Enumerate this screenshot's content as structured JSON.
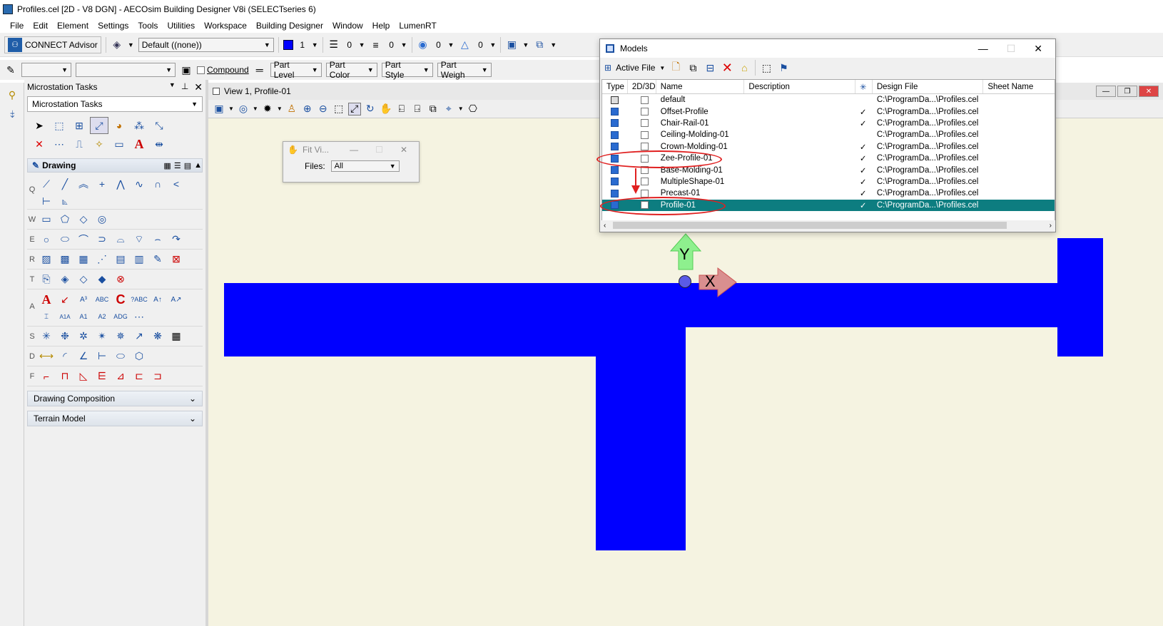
{
  "window": {
    "title": "Profiles.cel [2D - V8 DGN] - AECOsim Building Designer V8i (SELECTseries 6)"
  },
  "menu": [
    "File",
    "Edit",
    "Element",
    "Settings",
    "Tools",
    "Utilities",
    "Workspace",
    "Building Designer",
    "Window",
    "Help",
    "LumenRT"
  ],
  "toolbar1": {
    "connect_label": "CONNECT Advisor",
    "level_value": "Default ((none))",
    "color_value": "1",
    "style_value": "0",
    "weight_value": "0",
    "transparency_value": "0",
    "priority_value": "0"
  },
  "toolbar2": {
    "compound_label": "Compound",
    "part_level": "Part Level",
    "part_color": "Part Color",
    "part_style": "Part Style",
    "part_weight": "Part Weigh"
  },
  "tasks": {
    "panel_title": "Microstation Tasks",
    "combo_value": "Microstation Tasks",
    "drawing_section": "Drawing",
    "row_labels": [
      "Q",
      "W",
      "E",
      "R",
      "T",
      "A",
      "S",
      "D",
      "F"
    ],
    "collapsed": [
      "Drawing Composition",
      "Terrain Model"
    ]
  },
  "view": {
    "title": "View 1, Profile-01"
  },
  "fit_dialog": {
    "title": "Fit Vi...",
    "files_label": "Files:",
    "files_value": "All"
  },
  "models": {
    "title": "Models",
    "active_file": "Active File",
    "columns": [
      "Type",
      "2D/3D",
      "Name",
      "Description",
      "",
      "Design File",
      "Sheet Name"
    ],
    "rows": [
      {
        "name": "default",
        "check": "",
        "file": "C:\\ProgramDa...\\Profiles.cel"
      },
      {
        "name": "Offset-Profile",
        "check": "✓",
        "file": "C:\\ProgramDa...\\Profiles.cel"
      },
      {
        "name": "Chair-Rail-01",
        "check": "✓",
        "file": "C:\\ProgramDa...\\Profiles.cel"
      },
      {
        "name": "Ceiling-Molding-01",
        "check": "",
        "file": "C:\\ProgramDa...\\Profiles.cel"
      },
      {
        "name": "Crown-Molding-01",
        "check": "✓",
        "file": "C:\\ProgramDa...\\Profiles.cel"
      },
      {
        "name": "Zee-Profile-01",
        "check": "✓",
        "file": "C:\\ProgramDa...\\Profiles.cel"
      },
      {
        "name": "Base-Molding-01",
        "check": "✓",
        "file": "C:\\ProgramDa...\\Profiles.cel"
      },
      {
        "name": "MultipleShape-01",
        "check": "✓",
        "file": "C:\\ProgramDa...\\Profiles.cel"
      },
      {
        "name": "Precast-01",
        "check": "✓",
        "file": "C:\\ProgramDa...\\Profiles.cel"
      },
      {
        "name": "Profile-01",
        "check": "✓",
        "file": "C:\\ProgramDa...\\Profiles.cel"
      }
    ]
  },
  "axis": {
    "y": "Y",
    "x": "X"
  },
  "colors": {
    "shape": "#0000ff",
    "view_bg": "#f5f3e1",
    "selection": "#0d7d80",
    "annotation": "#e02020"
  }
}
